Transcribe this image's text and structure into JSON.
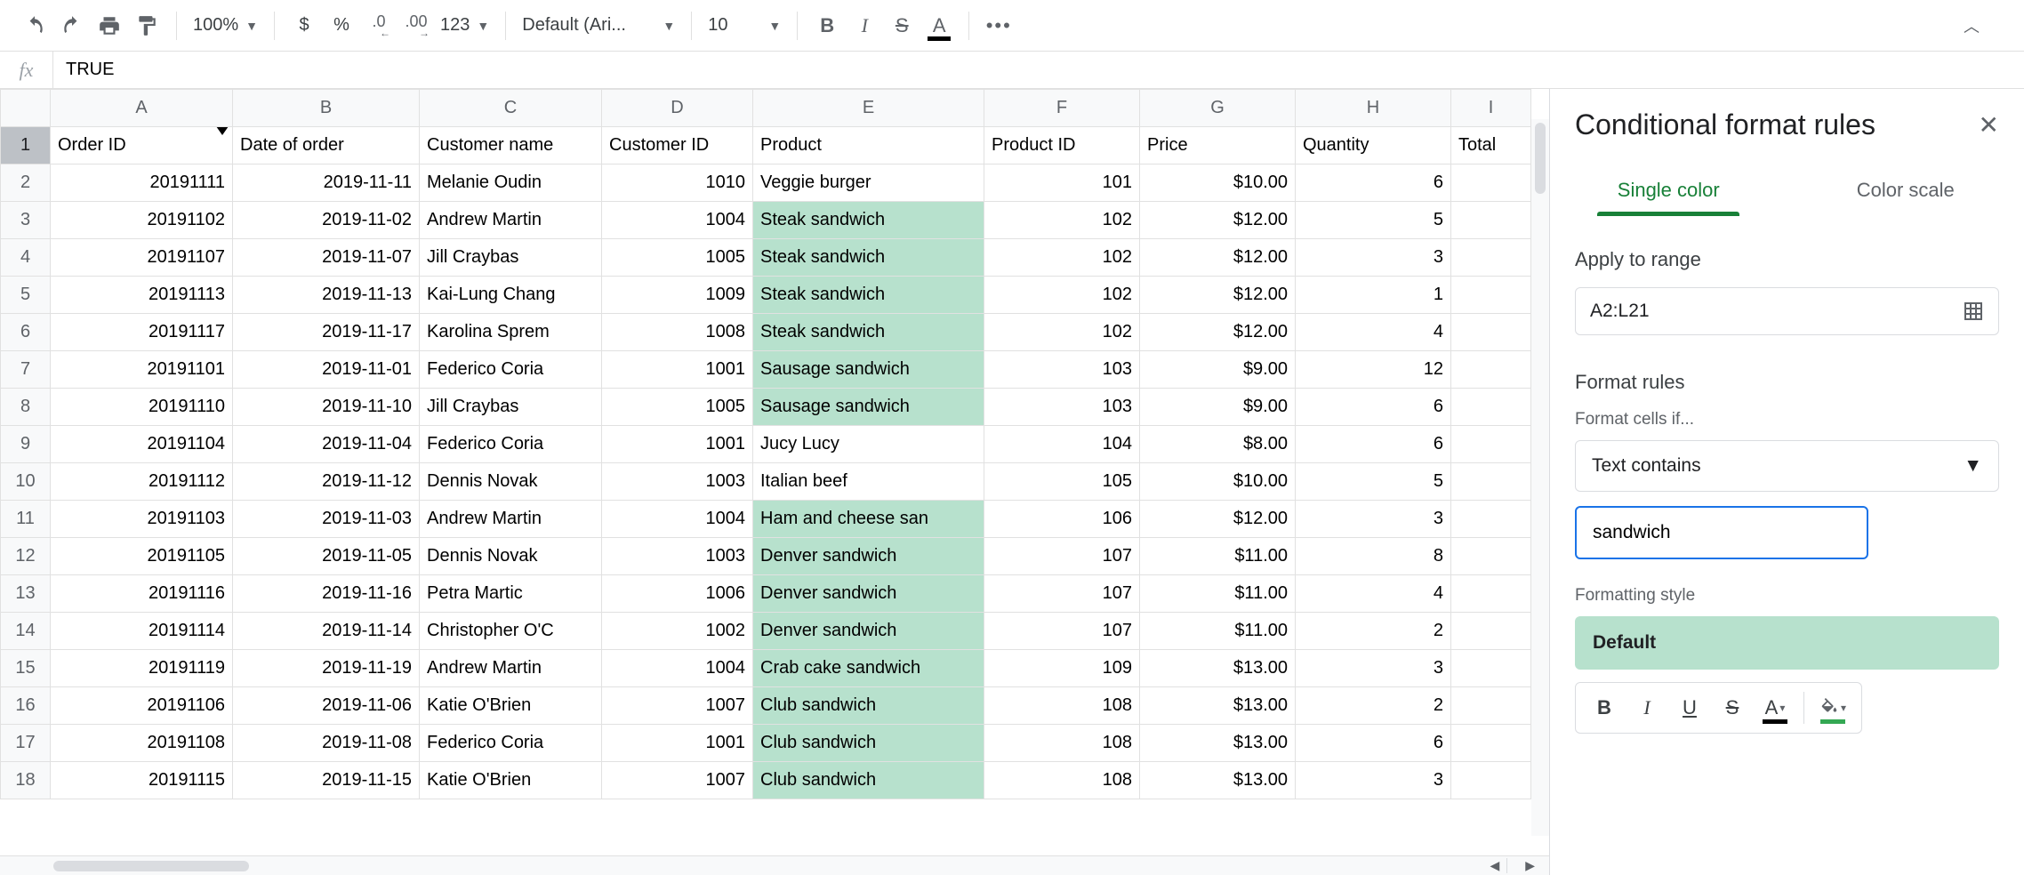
{
  "toolbar": {
    "zoom": "100%",
    "currency": "$",
    "percent": "%",
    "dec_dec": ".0",
    "inc_dec": ".00",
    "numfmt": "123",
    "font": "Default (Ari...",
    "font_size": "10",
    "more": "•••"
  },
  "formula_bar": {
    "fx": "fx",
    "value": "TRUE"
  },
  "grid": {
    "col_letters": [
      "A",
      "B",
      "C",
      "D",
      "E",
      "F",
      "G",
      "H",
      "I"
    ],
    "headers": [
      "Order ID",
      "Date of order",
      "Customer name",
      "Customer ID",
      "Product",
      "Product ID",
      "Price",
      "Quantity",
      "Total"
    ],
    "row_nums": [
      "1",
      "2",
      "3",
      "4",
      "5",
      "6",
      "7",
      "8",
      "9",
      "10",
      "11",
      "12",
      "13",
      "14",
      "15",
      "16",
      "17",
      "18"
    ],
    "rows": [
      {
        "a": "20191111",
        "b": "2019-11-11",
        "c": "Melanie Oudin",
        "d": "1010",
        "e": "Veggie burger",
        "f": "101",
        "g": "$10.00",
        "h": "6",
        "hl": false
      },
      {
        "a": "20191102",
        "b": "2019-11-02",
        "c": "Andrew Martin",
        "d": "1004",
        "e": "Steak sandwich",
        "f": "102",
        "g": "$12.00",
        "h": "5",
        "hl": true
      },
      {
        "a": "20191107",
        "b": "2019-11-07",
        "c": "Jill Craybas",
        "d": "1005",
        "e": "Steak sandwich",
        "f": "102",
        "g": "$12.00",
        "h": "3",
        "hl": true
      },
      {
        "a": "20191113",
        "b": "2019-11-13",
        "c": "Kai-Lung Chang",
        "d": "1009",
        "e": "Steak sandwich",
        "f": "102",
        "g": "$12.00",
        "h": "1",
        "hl": true
      },
      {
        "a": "20191117",
        "b": "2019-11-17",
        "c": "Karolina Sprem",
        "d": "1008",
        "e": "Steak sandwich",
        "f": "102",
        "g": "$12.00",
        "h": "4",
        "hl": true
      },
      {
        "a": "20191101",
        "b": "2019-11-01",
        "c": "Federico Coria",
        "d": "1001",
        "e": "Sausage sandwich",
        "f": "103",
        "g": "$9.00",
        "h": "12",
        "hl": true
      },
      {
        "a": "20191110",
        "b": "2019-11-10",
        "c": "Jill Craybas",
        "d": "1005",
        "e": "Sausage sandwich",
        "f": "103",
        "g": "$9.00",
        "h": "6",
        "hl": true
      },
      {
        "a": "20191104",
        "b": "2019-11-04",
        "c": "Federico Coria",
        "d": "1001",
        "e": "Jucy Lucy",
        "f": "104",
        "g": "$8.00",
        "h": "6",
        "hl": false
      },
      {
        "a": "20191112",
        "b": "2019-11-12",
        "c": "Dennis Novak",
        "d": "1003",
        "e": "Italian beef",
        "f": "105",
        "g": "$10.00",
        "h": "5",
        "hl": false
      },
      {
        "a": "20191103",
        "b": "2019-11-03",
        "c": "Andrew Martin",
        "d": "1004",
        "e": "Ham and cheese san",
        "f": "106",
        "g": "$12.00",
        "h": "3",
        "hl": true
      },
      {
        "a": "20191105",
        "b": "2019-11-05",
        "c": "Dennis Novak",
        "d": "1003",
        "e": "Denver sandwich",
        "f": "107",
        "g": "$11.00",
        "h": "8",
        "hl": true
      },
      {
        "a": "20191116",
        "b": "2019-11-16",
        "c": "Petra Martic",
        "d": "1006",
        "e": "Denver sandwich",
        "f": "107",
        "g": "$11.00",
        "h": "4",
        "hl": true
      },
      {
        "a": "20191114",
        "b": "2019-11-14",
        "c": "Christopher O'C",
        "d": "1002",
        "e": "Denver sandwich",
        "f": "107",
        "g": "$11.00",
        "h": "2",
        "hl": true
      },
      {
        "a": "20191119",
        "b": "2019-11-19",
        "c": "Andrew Martin",
        "d": "1004",
        "e": "Crab cake sandwich",
        "f": "109",
        "g": "$13.00",
        "h": "3",
        "hl": true
      },
      {
        "a": "20191106",
        "b": "2019-11-06",
        "c": "Katie O'Brien",
        "d": "1007",
        "e": "Club sandwich",
        "f": "108",
        "g": "$13.00",
        "h": "2",
        "hl": true
      },
      {
        "a": "20191108",
        "b": "2019-11-08",
        "c": "Federico Coria",
        "d": "1001",
        "e": "Club sandwich",
        "f": "108",
        "g": "$13.00",
        "h": "6",
        "hl": true
      },
      {
        "a": "20191115",
        "b": "2019-11-15",
        "c": "Katie O'Brien",
        "d": "1007",
        "e": "Club sandwich",
        "f": "108",
        "g": "$13.00",
        "h": "3",
        "hl": true
      }
    ]
  },
  "panel": {
    "title": "Conditional format rules",
    "tab_single": "Single color",
    "tab_scale": "Color scale",
    "apply_range_label": "Apply to range",
    "range": "A2:L21",
    "format_rules_label": "Format rules",
    "format_cells_if": "Format cells if...",
    "condition": "Text contains",
    "condition_value": "sandwich",
    "style_label": "Formatting style",
    "style_name": "Default",
    "bold": "B",
    "italic": "I",
    "underline": "U",
    "strike": "S",
    "textcolor": "A"
  }
}
